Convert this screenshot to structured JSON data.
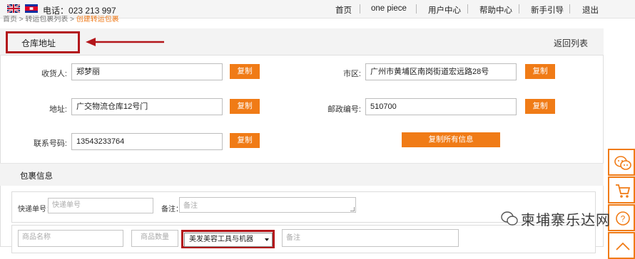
{
  "topbar": {
    "phone": "电话：023 213 997",
    "nav": [
      "首页",
      "one piece",
      "用户中心",
      "帮助中心",
      "新手引导",
      "退出"
    ]
  },
  "breadcrumb": {
    "home": "首页",
    "sep1": " > ",
    "parent": "转运包裹列表",
    "sep2": " > ",
    "current": "创建转运包裹"
  },
  "address_panel": {
    "title": "仓库地址",
    "back": "返回列表",
    "fields": {
      "receiver": {
        "label": "收货人:",
        "value": "郑梦丽"
      },
      "address": {
        "label": "地址:",
        "value": "广交物流仓库12号门"
      },
      "phone": {
        "label": "联系号码:",
        "value": "13543233764"
      },
      "city": {
        "label": "市区:",
        "value": "广州市黄埔区南岗街道宏远路28号"
      },
      "postcode": {
        "label": "邮政编号:",
        "value": "510700"
      }
    },
    "copy_label": "复制",
    "copy_all_label": "复制所有信息"
  },
  "package": {
    "title": "包裹信息",
    "tracking_label": "快递单号：",
    "tracking_placeholder": "快递单号",
    "remark_label": "备注：",
    "remark_placeholder": "备注",
    "item_name_placeholder": "商品名称",
    "item_qty_placeholder": "商品数量",
    "category_selected": "美发美容工具与机器",
    "item_remark_placeholder": "备注"
  },
  "watermark": "柬埔寨乐达网",
  "colors": {
    "accent": "#f07b16",
    "highlight": "#b3161b"
  },
  "side_tools": [
    "wechat-icon",
    "cart-icon",
    "help-icon",
    "scroll-up-icon"
  ]
}
